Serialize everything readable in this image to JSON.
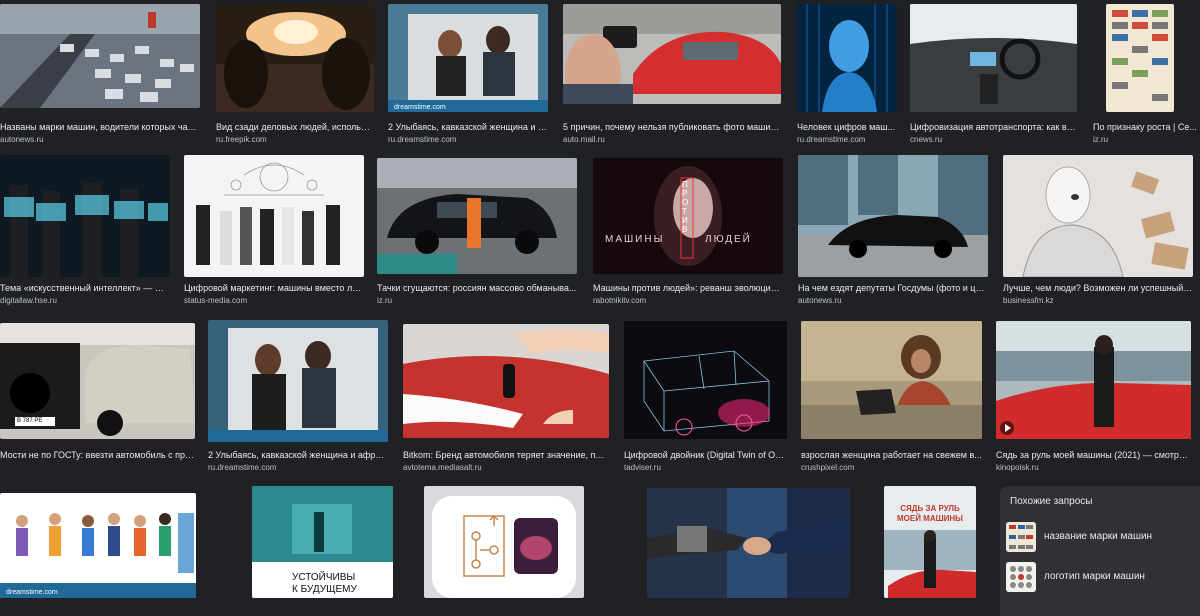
{
  "grid": {
    "row1": [
      {
        "caption": "Названы марки машин, водители которых чаще ...",
        "source": "autonews.ru"
      },
      {
        "caption": "Вид сзади деловых людей, использу...",
        "source": "ru.freepik.com"
      },
      {
        "caption": "2 Улыбаясь, кавказской женщина и а...",
        "source": "ru.dreamstime.com",
        "overlay": "dreamstime.com"
      },
      {
        "caption": "5 причин, почему нельзя публиковать фото машины...",
        "source": "auto.mail.ru"
      },
      {
        "caption": "Человек цифров маш...",
        "source": "ru.dreamstime.com"
      },
      {
        "caption": "Цифровизация автотранспорта: как в Р...",
        "source": "cnews.ru"
      },
      {
        "caption": "По признаку роста | Се...",
        "source": "iz.ru"
      }
    ],
    "row2": [
      {
        "caption": "Тема «искусственный интеллект» — Ново...",
        "source": "digitallaw.hse.ru"
      },
      {
        "caption": "Цифровой маркетинг: машины вместо лю...",
        "source": "status-media.com"
      },
      {
        "caption": "Тачки сгущаются: россиян массово обманыва...",
        "source": "iz.ru"
      },
      {
        "caption": "Машины против людей»: реванш эволюции. ...",
        "source": "rabotnikitv.com",
        "overlay_top": "ПРОТИВ",
        "overlay_left": "МАШИНЫ",
        "overlay_right": "ЛЮДЕЙ"
      },
      {
        "caption": "На чем ездят депутаты Госдумы (фото и цен...",
        "source": "autonews.ru"
      },
      {
        "caption": "Лучше, чем люди? Возможен ли успешный с...",
        "source": "businessfm.kz"
      }
    ],
    "row3": [
      {
        "caption": "Мости не по ГОСТу: ввезти автомобиль с пробег...",
        "source": "",
        "overlay": "В 787 РЕ"
      },
      {
        "caption": "2 Улыбаясь, кавказской женщина и афрuк...",
        "source": "ru.dreamstime.com"
      },
      {
        "caption": "Bitkom: Бренд автомобиля теряет значение, поку...",
        "source": "avtotema.mediasalt.ru"
      },
      {
        "caption": "Цифровой двойник (Digital Twin of Org...",
        "source": "tadviser.ru"
      },
      {
        "caption": "взрослая женщина работает на свежем в...",
        "source": "crushpixel.com"
      },
      {
        "caption": "Сядь за руль моей машины (2021) — смотреть...",
        "source": "kinopoisk.ru"
      }
    ],
    "row4": [
      {
        "overlay": "dreamstime.com"
      },
      {
        "overlay_line1": "УСТОЙЧИВЫ",
        "overlay_line2": "К БУДУЩЕМУ"
      },
      {},
      {},
      {
        "overlay_line1": "СЯДЬ ЗА РУЛЬ",
        "overlay_line2": "МОЕЙ МАШИНЫ"
      }
    ]
  },
  "related": {
    "title": "Похожие запросы",
    "items": [
      {
        "label": "название марки машин"
      },
      {
        "label": "логотип марки машин"
      }
    ]
  }
}
